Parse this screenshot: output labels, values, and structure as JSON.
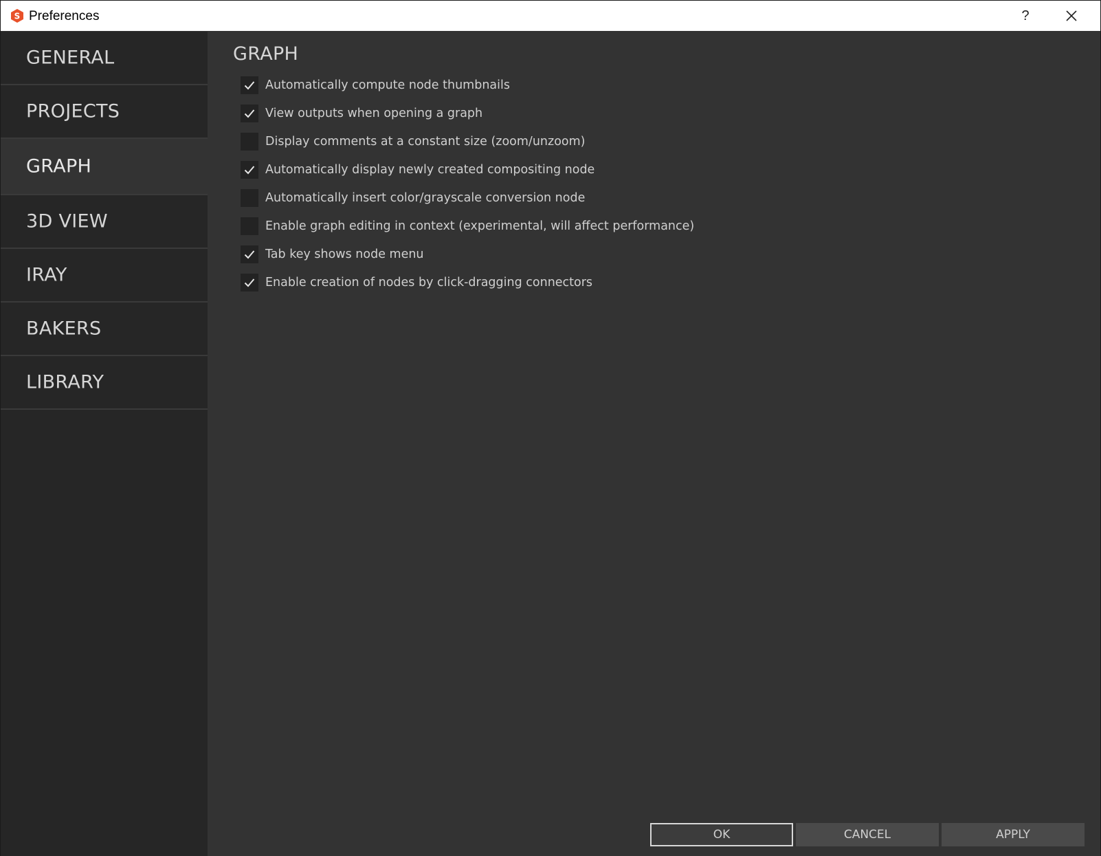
{
  "window": {
    "title": "Preferences",
    "help_label": "?"
  },
  "sidebar": {
    "items": [
      {
        "label": "GENERAL",
        "active": false
      },
      {
        "label": "PROJECTS",
        "active": false
      },
      {
        "label": "GRAPH",
        "active": true
      },
      {
        "label": "3D VIEW",
        "active": false
      },
      {
        "label": "IRAY",
        "active": false
      },
      {
        "label": "BAKERS",
        "active": false
      },
      {
        "label": "LIBRARY",
        "active": false
      }
    ]
  },
  "main": {
    "section_title": "GRAPH",
    "options": [
      {
        "label": "Automatically compute node thumbnails",
        "checked": true
      },
      {
        "label": "View outputs when opening a graph",
        "checked": true
      },
      {
        "label": "Display comments at a constant size (zoom/unzoom)",
        "checked": false
      },
      {
        "label": "Automatically display newly created compositing node",
        "checked": true
      },
      {
        "label": "Automatically insert color/grayscale conversion node",
        "checked": false
      },
      {
        "label": "Enable graph editing in context (experimental, will affect performance)",
        "checked": false
      },
      {
        "label": "Tab key shows node menu",
        "checked": true
      },
      {
        "label": "Enable creation of nodes by click-dragging connectors",
        "checked": true
      }
    ]
  },
  "footer": {
    "ok_label": "OK",
    "cancel_label": "CANCEL",
    "apply_label": "APPLY"
  },
  "colors": {
    "accent_icon": "#e8512a",
    "sidebar_bg": "#262626",
    "content_bg": "#333333"
  },
  "icons": {
    "app": "substance-designer-icon",
    "close": "close-icon",
    "check": "checkmark-icon"
  }
}
